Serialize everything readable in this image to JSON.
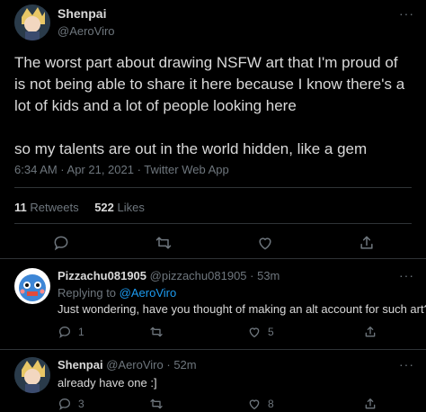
{
  "main_tweet": {
    "display_name": "Shenpai",
    "handle": "@AeroViro",
    "text_lines": [
      "The worst part about drawing NSFW art that I'm proud of",
      "is not being able to share it here because I know there's a",
      "lot of kids and a lot of people looking here"
    ],
    "text_line_2": "so my talents are out in the world hidden, like a gem",
    "meta": "6:34 AM · Apr 21, 2021 · Twitter Web App",
    "retweets_count": "11",
    "retweets_label": "Retweets",
    "likes_count": "522",
    "likes_label": "Likes"
  },
  "reply_1": {
    "display_name": "Pizzachu081905",
    "handle": "@pizzachu081905",
    "time": "· 53m",
    "replying_prefix": "Replying to",
    "replying_to": "@AeroViro",
    "text": "Just wondering, have you thought of making an alt account for such art?",
    "reply_count": "1",
    "retweet_count": "",
    "like_count": "5"
  },
  "reply_2": {
    "display_name": "Shenpai",
    "handle": "@AeroViro",
    "time": "· 52m",
    "text": "already have one :]",
    "reply_count": "3",
    "retweet_count": "",
    "like_count": "8"
  },
  "colors": {
    "background": "#000000",
    "text": "#d9d9d9",
    "muted": "#6e767d",
    "link": "#1d9bf0",
    "divider": "#2f3336"
  },
  "icons": [
    "reply-icon",
    "retweet-icon",
    "like-icon",
    "share-icon",
    "more-icon"
  ]
}
